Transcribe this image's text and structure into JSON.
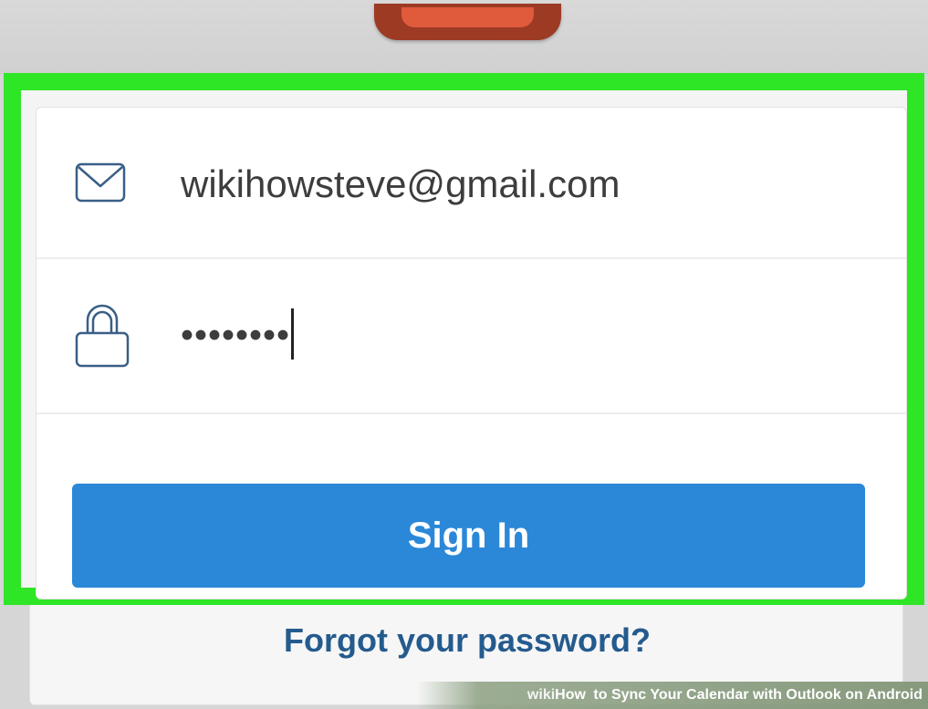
{
  "login": {
    "email_value": "wikihowsteve@gmail.com",
    "password_masked": "••••••••",
    "signin_label": "Sign In",
    "forgot_label": "Forgot your password?"
  },
  "icons": {
    "email": "envelope-icon",
    "password": "lock-icon"
  },
  "colors": {
    "highlight": "#2ee626",
    "button": "#2b88d8",
    "link": "#245b8e"
  },
  "watermark": {
    "brand_prefix": "wiki",
    "brand_suffix": "How",
    "title": "to Sync Your Calendar with Outlook on Android"
  }
}
